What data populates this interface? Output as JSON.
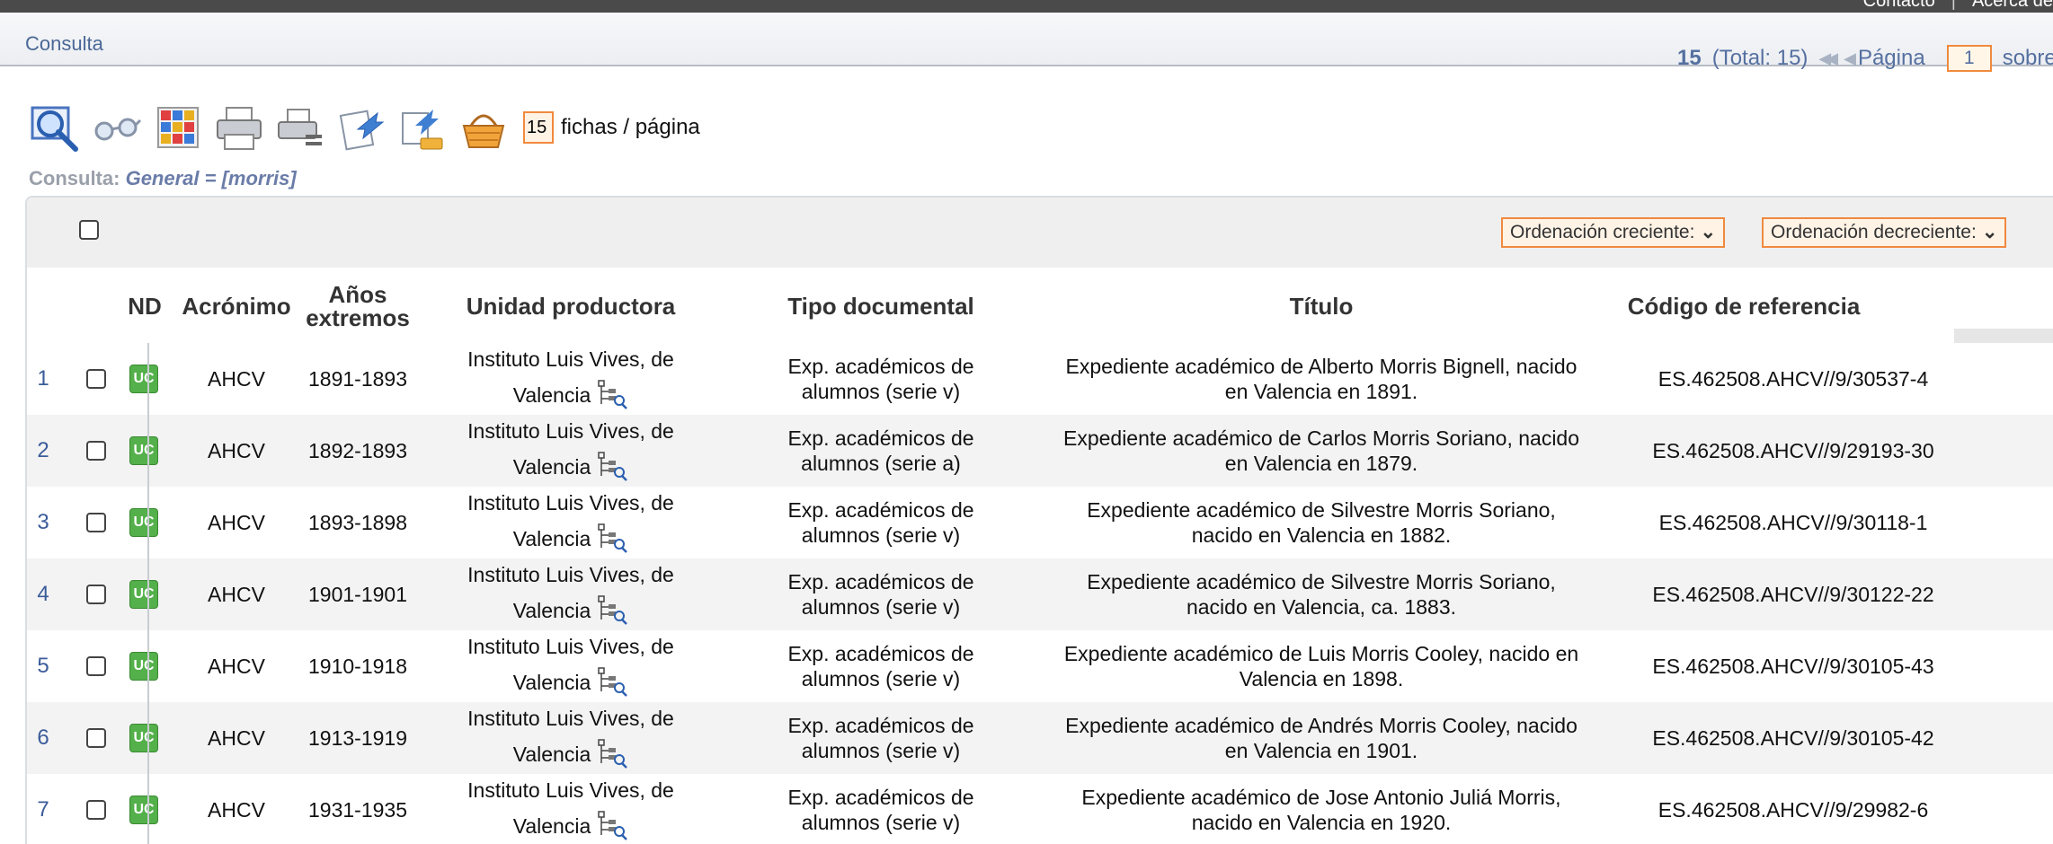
{
  "topbar": {
    "links": [
      "Contacto",
      "Acerca de"
    ]
  },
  "breadcrumb": {
    "label": "Consulta"
  },
  "pager": {
    "shown": "15",
    "total": "(Total: 15)",
    "page_label": "Página",
    "page_value": "1",
    "of_label": "sobre"
  },
  "toolbar": {
    "icons": [
      "search-icon",
      "glasses-icon",
      "grid-icon",
      "printer-icon",
      "print-list-icon",
      "export-icon",
      "export-settings-icon",
      "basket-icon"
    ],
    "per_page_value": "15",
    "per_page_label": "fichas / página"
  },
  "query": {
    "prefix": "Consulta:",
    "expression": "General = [morris]"
  },
  "sort": {
    "ascending": "Ordenación creciente:",
    "descending": "Ordenación decreciente:"
  },
  "columns": {
    "nd": "ND",
    "acronym": "Acrónimo",
    "years": "Años extremos",
    "unit": "Unidad productora",
    "doctype": "Tipo documental",
    "title": "Título",
    "ref": "Código de referencia"
  },
  "rows": [
    {
      "num": "1",
      "nd": "UC",
      "acronym": "AHCV",
      "years": "1891-1893",
      "unit_line1": "Instituto Luis Vives, de",
      "unit_line2": "Valencia",
      "doctype_line1": "Exp. académicos de",
      "doctype_line2": "alumnos (serie v)",
      "title_line1": "Expediente académico de Alberto Morris Bignell, nacido",
      "title_line2": "en Valencia en 1891.",
      "ref": "ES.462508.AHCV//9/30537-4"
    },
    {
      "num": "2",
      "nd": "UC",
      "acronym": "AHCV",
      "years": "1892-1893",
      "unit_line1": "Instituto Luis Vives, de",
      "unit_line2": "Valencia",
      "doctype_line1": "Exp. académicos de",
      "doctype_line2": "alumnos (serie a)",
      "title_line1": "Expediente académico de Carlos Morris Soriano, nacido",
      "title_line2": "en Valencia en 1879.",
      "ref": "ES.462508.AHCV//9/29193-30"
    },
    {
      "num": "3",
      "nd": "UC",
      "acronym": "AHCV",
      "years": "1893-1898",
      "unit_line1": "Instituto Luis Vives, de",
      "unit_line2": "Valencia",
      "doctype_line1": "Exp. académicos de",
      "doctype_line2": "alumnos (serie v)",
      "title_line1": "Expediente académico de Silvestre Morris Soriano,",
      "title_line2": "nacido en Valencia en 1882.",
      "ref": "ES.462508.AHCV//9/30118-1"
    },
    {
      "num": "4",
      "nd": "UC",
      "acronym": "AHCV",
      "years": "1901-1901",
      "unit_line1": "Instituto Luis Vives, de",
      "unit_line2": "Valencia",
      "doctype_line1": "Exp. académicos de",
      "doctype_line2": "alumnos (serie v)",
      "title_line1": "Expediente académico de Silvestre Morris Soriano,",
      "title_line2": "nacido en Valencia, ca. 1883.",
      "ref": "ES.462508.AHCV//9/30122-22"
    },
    {
      "num": "5",
      "nd": "UC",
      "acronym": "AHCV",
      "years": "1910-1918",
      "unit_line1": "Instituto Luis Vives, de",
      "unit_line2": "Valencia",
      "doctype_line1": "Exp. académicos de",
      "doctype_line2": "alumnos (serie v)",
      "title_line1": "Expediente académico de Luis Morris Cooley, nacido en",
      "title_line2": "Valencia en 1898.",
      "ref": "ES.462508.AHCV//9/30105-43"
    },
    {
      "num": "6",
      "nd": "UC",
      "acronym": "AHCV",
      "years": "1913-1919",
      "unit_line1": "Instituto Luis Vives, de",
      "unit_line2": "Valencia",
      "doctype_line1": "Exp. académicos de",
      "doctype_line2": "alumnos (serie v)",
      "title_line1": "Expediente académico de Andrés Morris Cooley, nacido",
      "title_line2": "en Valencia en 1901.",
      "ref": "ES.462508.AHCV//9/30105-42"
    },
    {
      "num": "7",
      "nd": "UC",
      "acronym": "AHCV",
      "years": "1931-1935",
      "unit_line1": "Instituto Luis Vives, de",
      "unit_line2": "Valencia",
      "doctype_line1": "Exp. académicos de",
      "doctype_line2": "alumnos (serie v)",
      "title_line1": "Expediente académico de Jose Antonio Juliá Morris,",
      "title_line2": "nacido en Valencia en 1920.",
      "ref": "ES.462508.AHCV//9/29982-6"
    }
  ]
}
